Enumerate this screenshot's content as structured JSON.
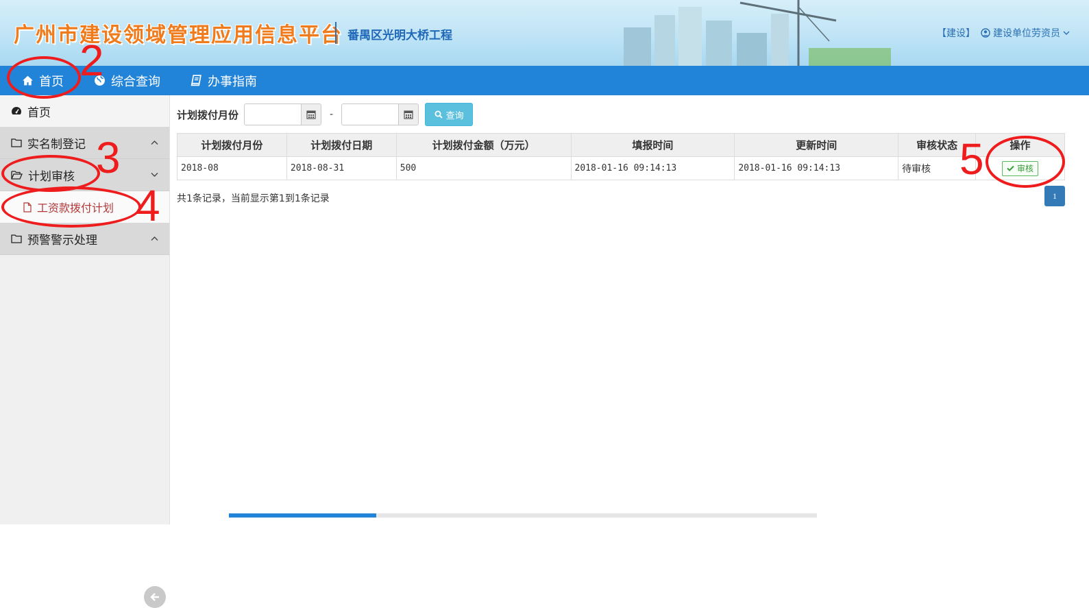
{
  "header": {
    "platform_title": "广州市建设领域管理应用信息平台",
    "project_name": "番禺区光明大桥工程",
    "role_tag": "【建设】",
    "user_name": "建设单位劳资员"
  },
  "nav": {
    "items": [
      {
        "label": "首页",
        "icon": "home-icon"
      },
      {
        "label": "综合查询",
        "icon": "globe-icon"
      },
      {
        "label": "办事指南",
        "icon": "book-icon"
      }
    ]
  },
  "sidebar": {
    "home_label": "首页",
    "groups": [
      {
        "label": "实名制登记",
        "icon": "folder-icon",
        "expanded": false
      },
      {
        "label": "计划审核",
        "icon": "folder-open-icon",
        "expanded": true,
        "children": [
          {
            "label": "工资款拨付计划",
            "icon": "file-icon"
          }
        ]
      },
      {
        "label": "预警警示处理",
        "icon": "folder-icon",
        "expanded": false
      }
    ]
  },
  "filter": {
    "label": "计划拨付月份",
    "start_value": "",
    "end_value": "",
    "separator": "-",
    "search_label": "查询"
  },
  "table": {
    "columns": [
      "计划拨付月份",
      "计划拨付日期",
      "计划拨付金额（万元）",
      "填报时间",
      "更新时间",
      "审核状态",
      "操作"
    ],
    "rows": [
      {
        "month": "2018-08",
        "date": "2018-08-31",
        "amount": "500",
        "filed_time": "2018-01-16 09:14:13",
        "updated_time": "2018-01-16 09:14:13",
        "status": "待审核",
        "action_label": "审核"
      }
    ]
  },
  "pagination": {
    "summary": "共1条记录，当前显示第1到1条记录",
    "current_page": "1"
  },
  "annotations": [
    "2",
    "3",
    "4",
    "5"
  ],
  "colors": {
    "nav_bg": "#2184d9",
    "title_orange": "#f07b1c",
    "annotation_red": "#ee1c1c",
    "search_btn": "#5bc0de",
    "pager_active": "#337ab7"
  }
}
